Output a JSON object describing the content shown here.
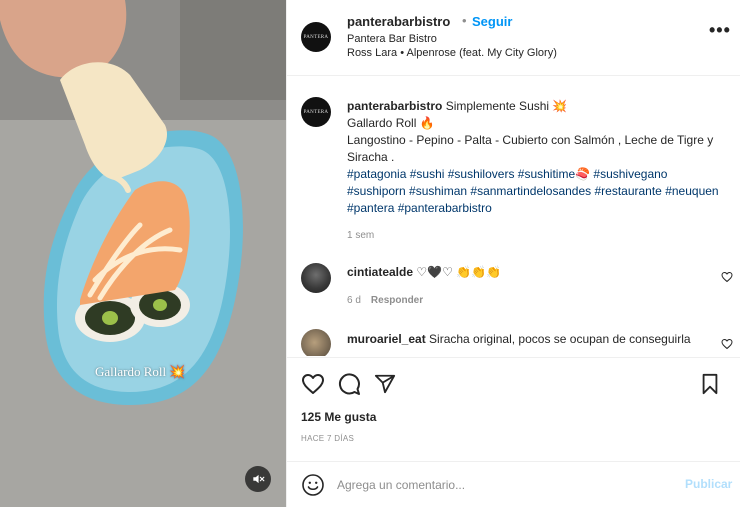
{
  "media": {
    "overlay_caption": "Gallardo Roll 💥"
  },
  "header": {
    "username": "panterabarbistro",
    "separator": "•",
    "follow_label": "Seguir",
    "location": "Pantera Bar Bistro",
    "audio": "Ross Lara • Alpenrose (feat. My City Glory)",
    "more_label": "•••",
    "avatar_text": "PANTERA"
  },
  "caption": {
    "username": "panterabarbistro",
    "line1": " Simplemente Sushi 💥",
    "line2": "Gallardo Roll 🔥",
    "line3": "Langostino - Pepino - Palta - Cubierto con Salmón , Leche de Tigre y Siracha .",
    "hashtags": "#patagonia #sushi #sushilovers #sushitime🍣 #sushivegano #sushiporn #sushiman #sanmartindelosandes #restaurante #neuquen #pantera #panterabarbistro",
    "time": "1 sem"
  },
  "comments": [
    {
      "username": "cintiatealde",
      "text": " ♡🖤♡ 👏👏👏",
      "time": "6 d",
      "reply_label": "Responder"
    },
    {
      "username": "muroariel_eat",
      "text": " Siracha original, pocos se ocupan de conseguirla"
    }
  ],
  "actions": {
    "likes": "125 Me gusta",
    "date": "HACE 7 DÍAS"
  },
  "add_comment": {
    "placeholder": "Agrega un comentario...",
    "publish_label": "Publicar"
  },
  "colors": {
    "link_blue": "#0095f6",
    "hashtag": "#00376b",
    "muted": "#8e8e8e",
    "publish_disabled": "#b2dffc"
  }
}
